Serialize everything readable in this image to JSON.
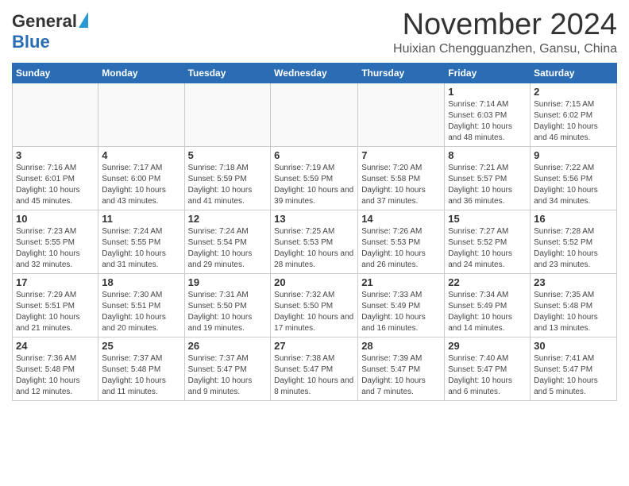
{
  "header": {
    "logo_general": "General",
    "logo_blue": "Blue",
    "month": "November 2024",
    "location": "Huixian Chengguanzhen, Gansu, China"
  },
  "days_of_week": [
    "Sunday",
    "Monday",
    "Tuesday",
    "Wednesday",
    "Thursday",
    "Friday",
    "Saturday"
  ],
  "weeks": [
    [
      {
        "day": "",
        "info": ""
      },
      {
        "day": "",
        "info": ""
      },
      {
        "day": "",
        "info": ""
      },
      {
        "day": "",
        "info": ""
      },
      {
        "day": "",
        "info": ""
      },
      {
        "day": "1",
        "info": "Sunrise: 7:14 AM\nSunset: 6:03 PM\nDaylight: 10 hours and 48 minutes."
      },
      {
        "day": "2",
        "info": "Sunrise: 7:15 AM\nSunset: 6:02 PM\nDaylight: 10 hours and 46 minutes."
      }
    ],
    [
      {
        "day": "3",
        "info": "Sunrise: 7:16 AM\nSunset: 6:01 PM\nDaylight: 10 hours and 45 minutes."
      },
      {
        "day": "4",
        "info": "Sunrise: 7:17 AM\nSunset: 6:00 PM\nDaylight: 10 hours and 43 minutes."
      },
      {
        "day": "5",
        "info": "Sunrise: 7:18 AM\nSunset: 5:59 PM\nDaylight: 10 hours and 41 minutes."
      },
      {
        "day": "6",
        "info": "Sunrise: 7:19 AM\nSunset: 5:59 PM\nDaylight: 10 hours and 39 minutes."
      },
      {
        "day": "7",
        "info": "Sunrise: 7:20 AM\nSunset: 5:58 PM\nDaylight: 10 hours and 37 minutes."
      },
      {
        "day": "8",
        "info": "Sunrise: 7:21 AM\nSunset: 5:57 PM\nDaylight: 10 hours and 36 minutes."
      },
      {
        "day": "9",
        "info": "Sunrise: 7:22 AM\nSunset: 5:56 PM\nDaylight: 10 hours and 34 minutes."
      }
    ],
    [
      {
        "day": "10",
        "info": "Sunrise: 7:23 AM\nSunset: 5:55 PM\nDaylight: 10 hours and 32 minutes."
      },
      {
        "day": "11",
        "info": "Sunrise: 7:24 AM\nSunset: 5:55 PM\nDaylight: 10 hours and 31 minutes."
      },
      {
        "day": "12",
        "info": "Sunrise: 7:24 AM\nSunset: 5:54 PM\nDaylight: 10 hours and 29 minutes."
      },
      {
        "day": "13",
        "info": "Sunrise: 7:25 AM\nSunset: 5:53 PM\nDaylight: 10 hours and 28 minutes."
      },
      {
        "day": "14",
        "info": "Sunrise: 7:26 AM\nSunset: 5:53 PM\nDaylight: 10 hours and 26 minutes."
      },
      {
        "day": "15",
        "info": "Sunrise: 7:27 AM\nSunset: 5:52 PM\nDaylight: 10 hours and 24 minutes."
      },
      {
        "day": "16",
        "info": "Sunrise: 7:28 AM\nSunset: 5:52 PM\nDaylight: 10 hours and 23 minutes."
      }
    ],
    [
      {
        "day": "17",
        "info": "Sunrise: 7:29 AM\nSunset: 5:51 PM\nDaylight: 10 hours and 21 minutes."
      },
      {
        "day": "18",
        "info": "Sunrise: 7:30 AM\nSunset: 5:51 PM\nDaylight: 10 hours and 20 minutes."
      },
      {
        "day": "19",
        "info": "Sunrise: 7:31 AM\nSunset: 5:50 PM\nDaylight: 10 hours and 19 minutes."
      },
      {
        "day": "20",
        "info": "Sunrise: 7:32 AM\nSunset: 5:50 PM\nDaylight: 10 hours and 17 minutes."
      },
      {
        "day": "21",
        "info": "Sunrise: 7:33 AM\nSunset: 5:49 PM\nDaylight: 10 hours and 16 minutes."
      },
      {
        "day": "22",
        "info": "Sunrise: 7:34 AM\nSunset: 5:49 PM\nDaylight: 10 hours and 14 minutes."
      },
      {
        "day": "23",
        "info": "Sunrise: 7:35 AM\nSunset: 5:48 PM\nDaylight: 10 hours and 13 minutes."
      }
    ],
    [
      {
        "day": "24",
        "info": "Sunrise: 7:36 AM\nSunset: 5:48 PM\nDaylight: 10 hours and 12 minutes."
      },
      {
        "day": "25",
        "info": "Sunrise: 7:37 AM\nSunset: 5:48 PM\nDaylight: 10 hours and 11 minutes."
      },
      {
        "day": "26",
        "info": "Sunrise: 7:37 AM\nSunset: 5:47 PM\nDaylight: 10 hours and 9 minutes."
      },
      {
        "day": "27",
        "info": "Sunrise: 7:38 AM\nSunset: 5:47 PM\nDaylight: 10 hours and 8 minutes."
      },
      {
        "day": "28",
        "info": "Sunrise: 7:39 AM\nSunset: 5:47 PM\nDaylight: 10 hours and 7 minutes."
      },
      {
        "day": "29",
        "info": "Sunrise: 7:40 AM\nSunset: 5:47 PM\nDaylight: 10 hours and 6 minutes."
      },
      {
        "day": "30",
        "info": "Sunrise: 7:41 AM\nSunset: 5:47 PM\nDaylight: 10 hours and 5 minutes."
      }
    ]
  ]
}
